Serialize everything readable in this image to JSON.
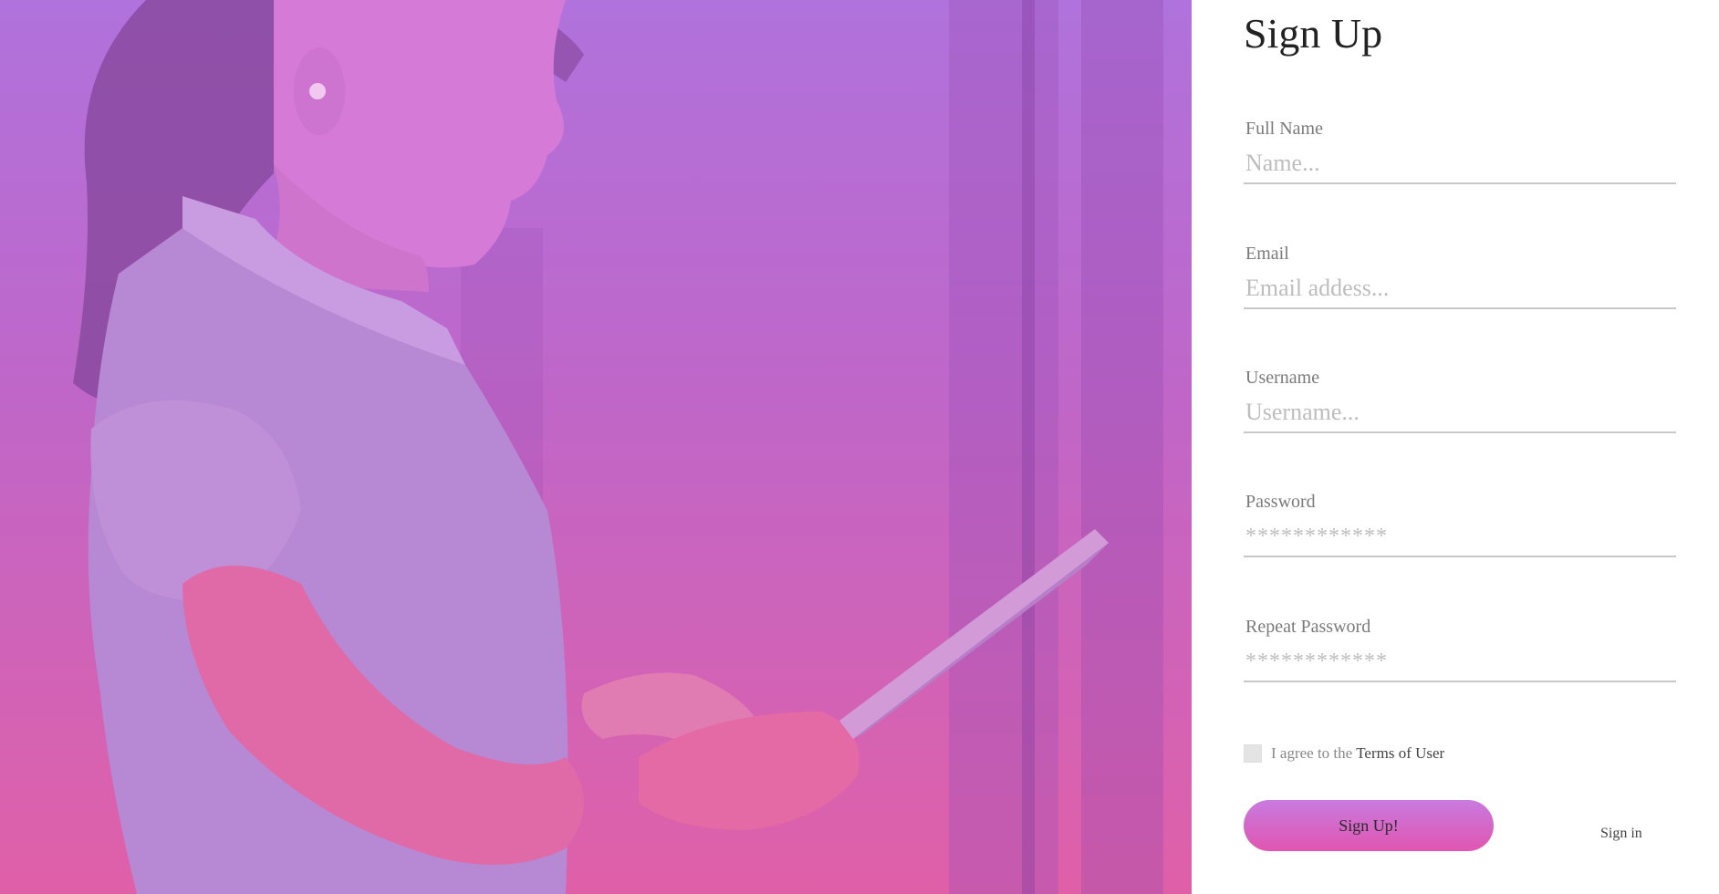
{
  "hero": {
    "image_semantic": "woman-using-tablet-photo",
    "overlay_colors": [
      "#b072dc",
      "#c066c8",
      "#e060a8"
    ]
  },
  "form": {
    "title": "Sign Up",
    "fields": [
      {
        "label": "Full Name",
        "placeholder": "Name...",
        "type": "text"
      },
      {
        "label": "Email",
        "placeholder": "Email addess...",
        "type": "email"
      },
      {
        "label": "Username",
        "placeholder": "Username...",
        "type": "text"
      },
      {
        "label": "Password",
        "placeholder": "************",
        "type": "password"
      },
      {
        "label": "Repeat Password",
        "placeholder": "************",
        "type": "password"
      }
    ],
    "agree_text": "I agree to the",
    "terms_link": "Terms of User",
    "submit_label": "Sign Up!",
    "signin_link": "Sign in",
    "accent_gradient": [
      "#c97ae0",
      "#e056b0"
    ]
  }
}
